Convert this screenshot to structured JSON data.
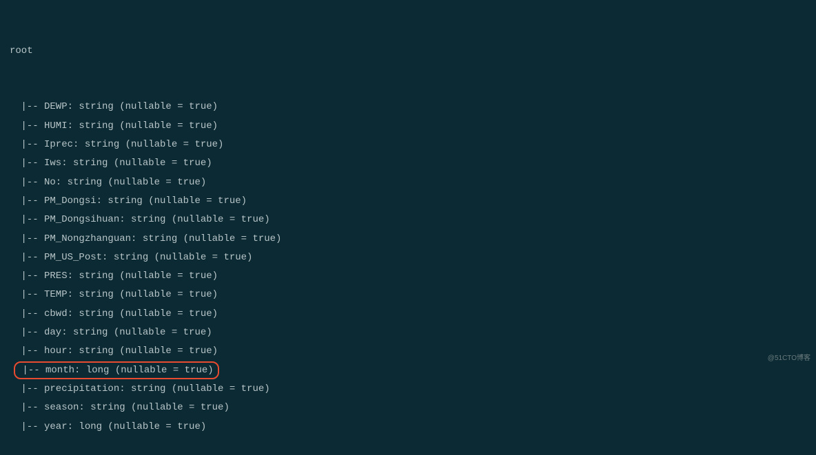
{
  "schema": {
    "root_label": "root",
    "prefix": " |-- ",
    "fields": [
      {
        "name": "DEWP",
        "type": "string",
        "nullable": "true",
        "highlighted": false
      },
      {
        "name": "HUMI",
        "type": "string",
        "nullable": "true",
        "highlighted": false
      },
      {
        "name": "Iprec",
        "type": "string",
        "nullable": "true",
        "highlighted": false
      },
      {
        "name": "Iws",
        "type": "string",
        "nullable": "true",
        "highlighted": false
      },
      {
        "name": "No",
        "type": "string",
        "nullable": "true",
        "highlighted": false
      },
      {
        "name": "PM_Dongsi",
        "type": "string",
        "nullable": "true",
        "highlighted": false
      },
      {
        "name": "PM_Dongsihuan",
        "type": "string",
        "nullable": "true",
        "highlighted": false
      },
      {
        "name": "PM_Nongzhanguan",
        "type": "string",
        "nullable": "true",
        "highlighted": false
      },
      {
        "name": "PM_US_Post",
        "type": "string",
        "nullable": "true",
        "highlighted": false
      },
      {
        "name": "PRES",
        "type": "string",
        "nullable": "true",
        "highlighted": false
      },
      {
        "name": "TEMP",
        "type": "string",
        "nullable": "true",
        "highlighted": false
      },
      {
        "name": "cbwd",
        "type": "string",
        "nullable": "true",
        "highlighted": false
      },
      {
        "name": "day",
        "type": "string",
        "nullable": "true",
        "highlighted": false
      },
      {
        "name": "hour",
        "type": "string",
        "nullable": "true",
        "highlighted": false
      },
      {
        "name": "month",
        "type": "long",
        "nullable": "true",
        "highlighted": true
      },
      {
        "name": "precipitation",
        "type": "string",
        "nullable": "true",
        "highlighted": false
      },
      {
        "name": "season",
        "type": "string",
        "nullable": "true",
        "highlighted": false
      },
      {
        "name": "year",
        "type": "long",
        "nullable": "true",
        "highlighted": false
      }
    ]
  },
  "watermark": "@51CTO博客"
}
